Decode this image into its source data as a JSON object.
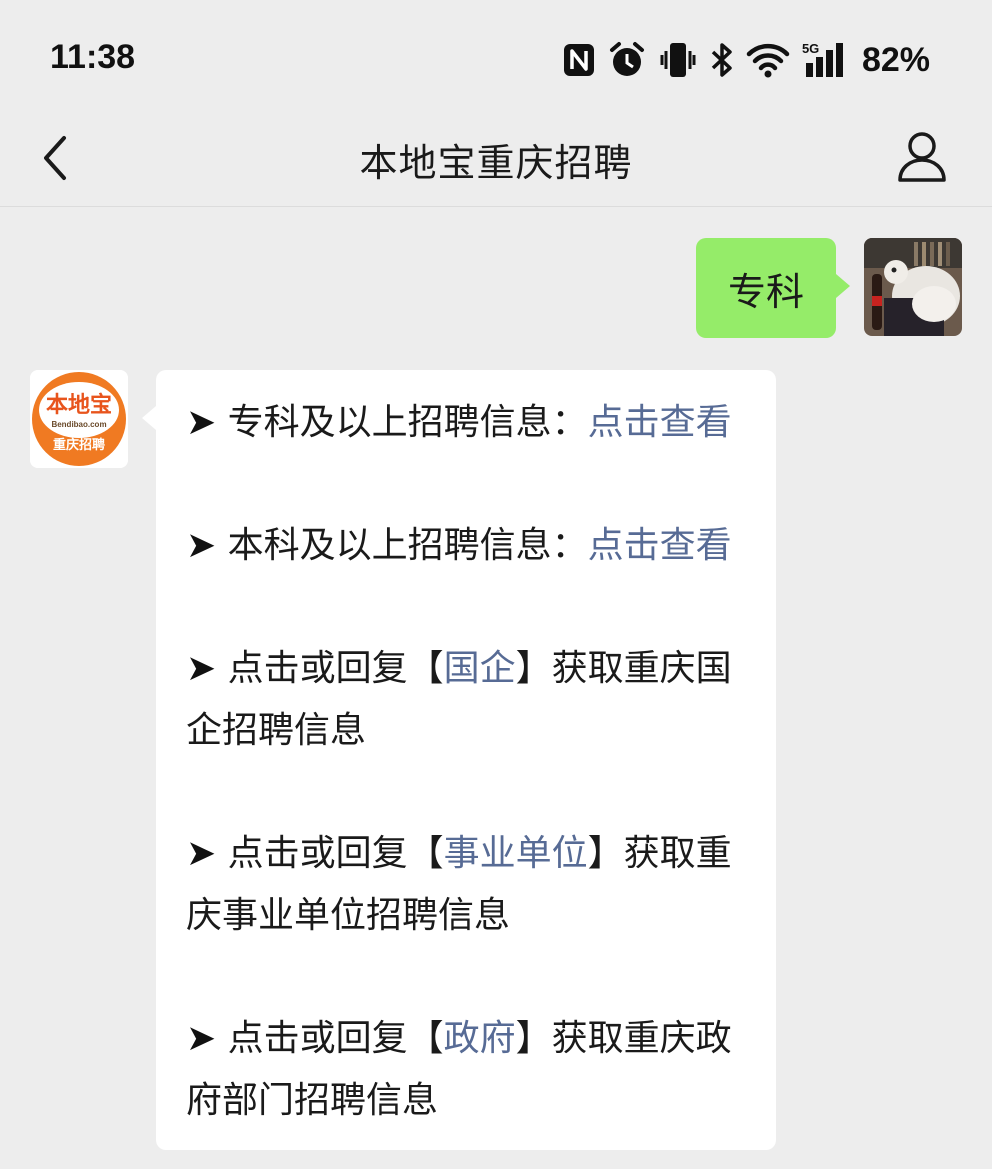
{
  "status_bar": {
    "time": "11:38",
    "network": "5G",
    "battery": "82%",
    "icons": [
      "nfc-icon",
      "alarm-icon",
      "vibrate-icon",
      "bluetooth-icon",
      "wifi-icon",
      "cellular-signal-icon"
    ]
  },
  "nav": {
    "title": "本地宝重庆招聘",
    "back_icon": "chevron-left-icon",
    "profile_icon": "person-icon"
  },
  "sent_message": {
    "text": "专科"
  },
  "bot_avatar": {
    "brand_top": "本地宝",
    "brand_url": "Bendibao.com",
    "brand_bottom": "重庆招聘",
    "colors": {
      "orange": "#f07a22",
      "white": "#ffffff"
    }
  },
  "received_message": {
    "arrow": "➤",
    "items": [
      {
        "prefix": "专科及以上招聘信息：",
        "link": "点击查看"
      },
      {
        "prefix": "本科及以上招聘信息：",
        "link": "点击查看"
      },
      {
        "prefix": "点击或回复【",
        "link": "国企",
        "suffix": "】获取重庆国企招聘信息"
      },
      {
        "prefix": "点击或回复【",
        "link": "事业单位",
        "suffix": "】获取重庆事业单位招聘信息"
      },
      {
        "prefix": "点击或回复【",
        "link": "政府",
        "suffix": "】获取重庆政府部门招聘信息"
      }
    ]
  },
  "colors": {
    "background": "#ededed",
    "sent_bubble": "#95ec69",
    "received_bubble": "#ffffff",
    "link": "#576b95"
  }
}
